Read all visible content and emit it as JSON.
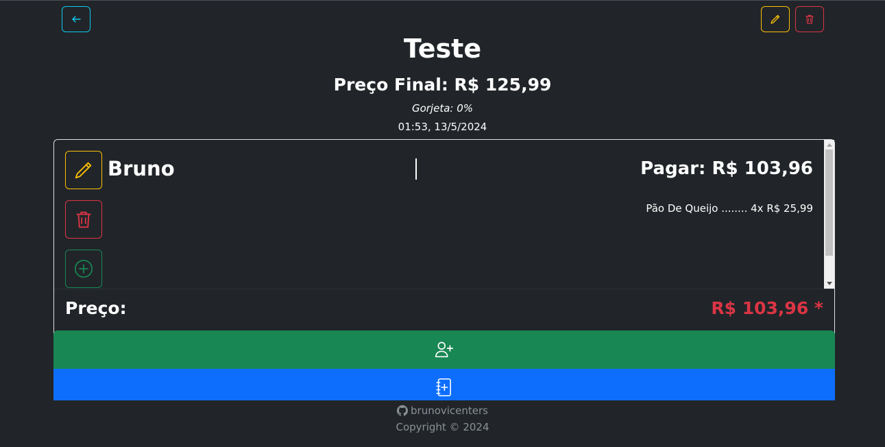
{
  "header": {
    "title": "Teste",
    "final_price": "Preço Final: R$ 125,99",
    "tip": "Gorjeta: 0%",
    "datetime": "01:53, 13/5/2024"
  },
  "people": [
    {
      "name": "Bruno",
      "pay": "Pagar: R$ 103,96",
      "items": [
        {
          "line": "Pão De Queijo ........ 4x R$ 25,99"
        }
      ]
    }
  ],
  "summary": {
    "price_label": "Preço:",
    "price_value": "R$ 103,96 *"
  },
  "footer": {
    "github_user": "brunovicenters",
    "copyright": "Copyright © 2024"
  },
  "icons": {
    "back": "arrow-left-icon",
    "edit": "pencil-icon",
    "delete": "trash-icon",
    "add": "plus-circle-icon",
    "add_person": "person-plus-icon",
    "add_item": "journal-plus-icon",
    "github": "github-icon"
  },
  "colors": {
    "background": "#212529",
    "info": "#0dcaf0",
    "warning": "#ffc107",
    "danger": "#dc3545",
    "success": "#198754",
    "primary": "#0d6efd",
    "muted": "#8c9196"
  }
}
